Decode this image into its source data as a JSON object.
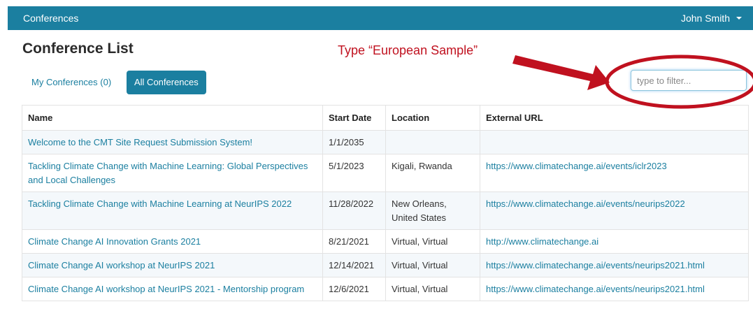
{
  "navbar": {
    "brand": "Conferences",
    "user_name": "John Smith"
  },
  "page_title": "Conference List",
  "annotation": {
    "text": "Type “European Sample”",
    "color": "#c0111f"
  },
  "tabs": [
    {
      "label": "My Conferences (0)",
      "active": false
    },
    {
      "label": "All Conferences",
      "active": true
    }
  ],
  "filter": {
    "placeholder": "type to filter...",
    "value": ""
  },
  "table": {
    "headers": [
      "Name",
      "Start Date",
      "Location",
      "External URL"
    ],
    "rows": [
      {
        "name": "Welcome to the CMT Site Request Submission System!",
        "start_date": "1/1/2035",
        "location": "",
        "url": ""
      },
      {
        "name": "Tackling Climate Change with Machine Learning: Global Perspectives and Local Challenges",
        "start_date": "5/1/2023",
        "location": "Kigali, Rwanda",
        "url": "https://www.climatechange.ai/events/iclr2023"
      },
      {
        "name": "Tackling Climate Change with Machine Learning at NeurIPS 2022",
        "start_date": "11/28/2022",
        "location": "New Orleans, United States",
        "url": "https://www.climatechange.ai/events/neurips2022"
      },
      {
        "name": "Climate Change AI Innovation Grants 2021",
        "start_date": "8/21/2021",
        "location": "Virtual, Virtual",
        "url": "http://www.climatechange.ai"
      },
      {
        "name": "Climate Change AI workshop at NeurIPS 2021",
        "start_date": "12/14/2021",
        "location": "Virtual, Virtual",
        "url": "https://www.climatechange.ai/events/neurips2021.html"
      },
      {
        "name": "Climate Change AI workshop at NeurIPS 2021 - Mentorship program",
        "start_date": "12/6/2021",
        "location": "Virtual, Virtual",
        "url": "https://www.climatechange.ai/events/neurips2021.html"
      }
    ]
  },
  "colors": {
    "brand": "#1b7fa0",
    "annotation_red": "#c0111f"
  }
}
